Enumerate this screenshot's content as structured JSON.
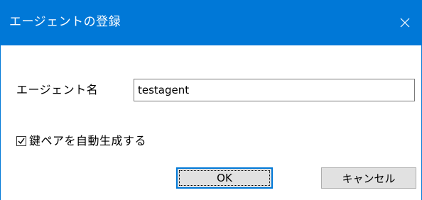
{
  "window": {
    "title": "エージェントの登録",
    "close_icon": "close-icon",
    "accent_color": "#0078d7"
  },
  "form": {
    "agent_name_label": "エージェント名",
    "agent_name_value": "testagent",
    "generate_keypair_label": "鍵ペアを自動生成する",
    "generate_keypair_checked": true
  },
  "buttons": {
    "ok_label": "OK",
    "cancel_label": "キャンセル"
  }
}
